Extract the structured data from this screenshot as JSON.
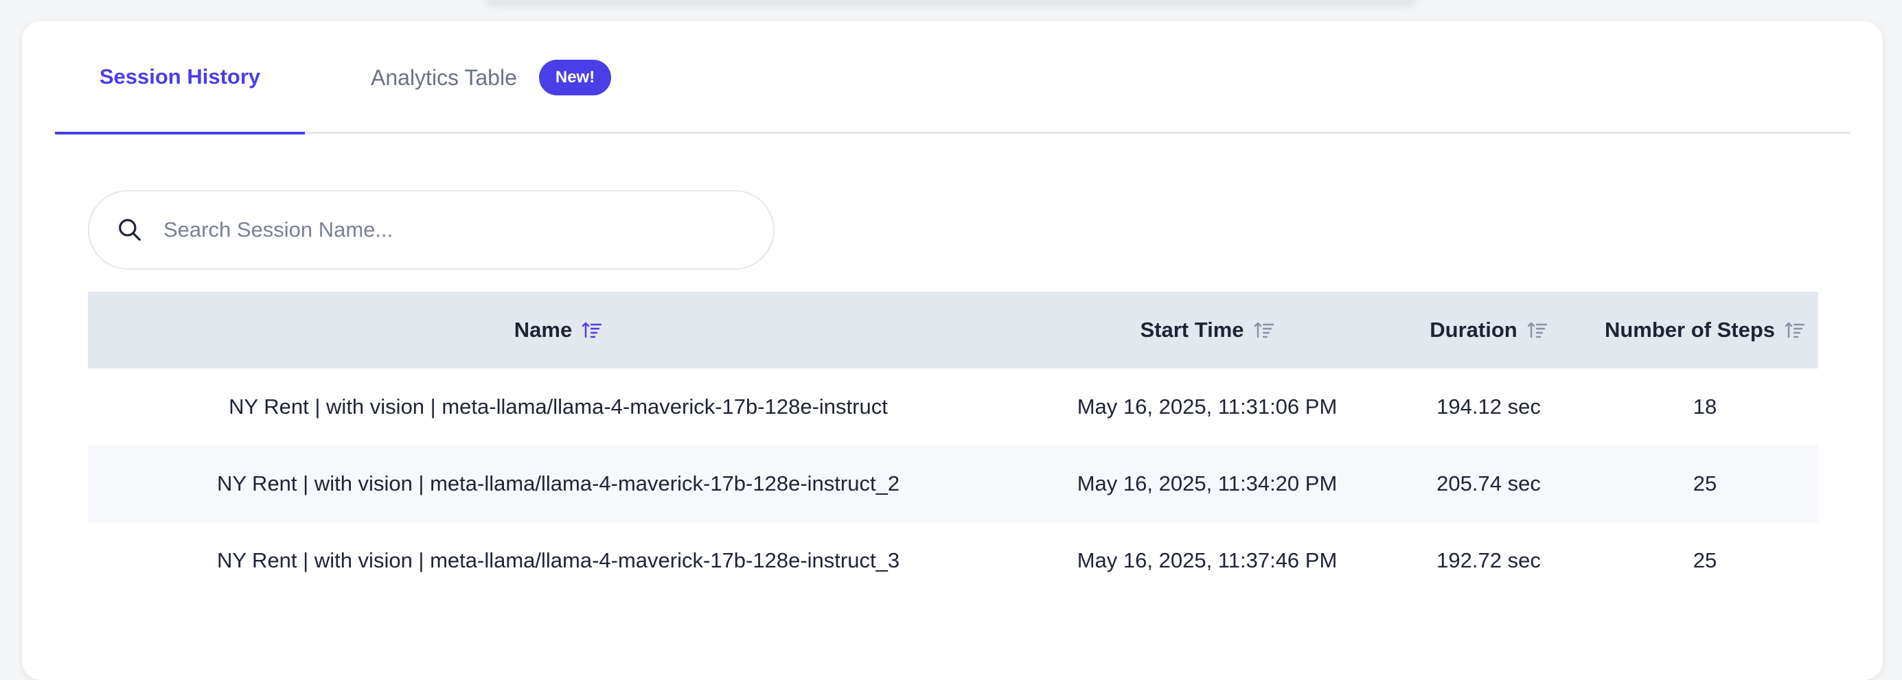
{
  "tabs": {
    "session_history": "Session History",
    "analytics_table": "Analytics Table",
    "new_badge": "New!"
  },
  "search": {
    "placeholder": "Search Session Name...",
    "value": ""
  },
  "table": {
    "columns": {
      "name": "Name",
      "start_time": "Start Time",
      "duration": "Duration",
      "steps": "Number of Steps"
    },
    "rows": [
      {
        "name": "NY Rent | with vision | meta-llama/llama-4-maverick-17b-128e-instruct",
        "start_time": "May 16, 2025, 11:31:06 PM",
        "duration": "194.12 sec",
        "steps": "18"
      },
      {
        "name": "NY Rent | with vision | meta-llama/llama-4-maverick-17b-128e-instruct_2",
        "start_time": "May 16, 2025, 11:34:20 PM",
        "duration": "205.74 sec",
        "steps": "25"
      },
      {
        "name": "NY Rent | with vision | meta-llama/llama-4-maverick-17b-128e-instruct_3",
        "start_time": "May 16, 2025, 11:37:46 PM",
        "duration": "192.72 sec",
        "steps": "25"
      }
    ]
  },
  "icons": {
    "search": "search-icon",
    "sort": "sort-icon"
  },
  "colors": {
    "accent": "#4a3ee6",
    "header_bg": "#e3e7ee",
    "alt_row_bg": "#f6f8fc"
  }
}
